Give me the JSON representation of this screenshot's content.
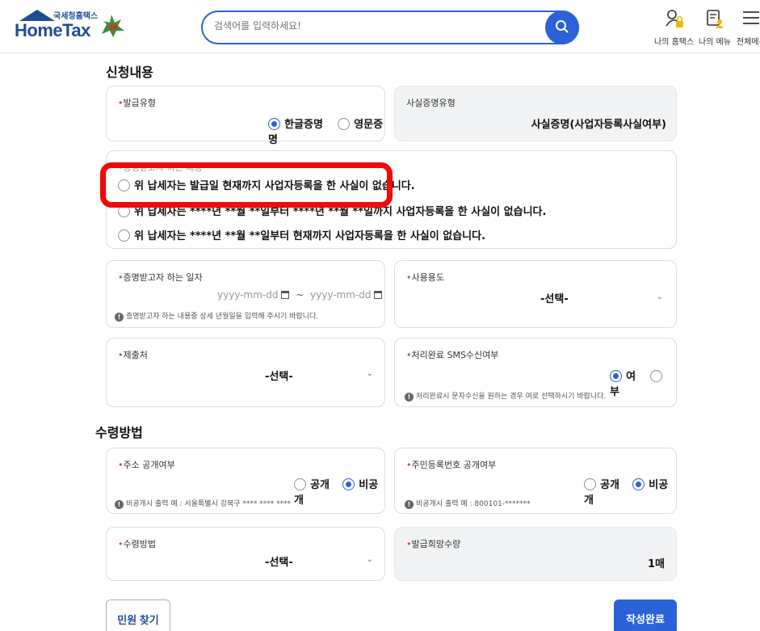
{
  "header": {
    "logo_small": "국세청홈택스",
    "logo_big": "HomeTax",
    "search_placeholder": "검색어를 입력하세요!",
    "nav": [
      {
        "label": "나의 홈택스",
        "icon": "person-lock-icon"
      },
      {
        "label": "나의 메뉴",
        "icon": "document-person-icon"
      },
      {
        "label": "전체메뉴",
        "icon": "menu-icon"
      }
    ]
  },
  "apply": {
    "title": "신청내용",
    "issue_type": {
      "label": "발급유형",
      "options": [
        "한글증명",
        "영문증명"
      ],
      "selected": "한글증명"
    },
    "fact_type": {
      "label": "사실증명유형",
      "value": "사실증명(사업자등록사실여부)"
    },
    "content": {
      "label": "증명받고자 하는 내용",
      "options": [
        "위 납세자는 발급일 현재까지 사업자등록을 한 사실이 없습니다.",
        "위 납세자는 ****년 **월 **일부터 ****년 **월 **일까지 사업자등록을 한 사실이 없습니다.",
        "위 납세자는 ****년 **월 **일부터 현재까지 사업자등록을 한 사실이 없습니다."
      ]
    },
    "date": {
      "label": "증명받고자 하는 일자",
      "from_placeholder": "yyyy-mm-dd",
      "separator": "~",
      "to_placeholder": "yyyy-mm-dd",
      "hint": "증명받고자 하는 내용중 상세 년월일을 입력해 주시기 바랍니다."
    },
    "usage": {
      "label": "사용용도",
      "value": "-선택-"
    },
    "submit_to": {
      "label": "제출처",
      "value": "-선택-"
    },
    "sms": {
      "label": "처리완료 SMS수신여부",
      "options": [
        "여",
        "부"
      ],
      "selected": "여",
      "hint": "처리완료시 문자수신을 원하는 경우 여로 선택하시기 바랍니다."
    }
  },
  "receive": {
    "title": "수령방법",
    "address_public": {
      "label": "주소 공개여부",
      "options": [
        "공개",
        "비공개"
      ],
      "selected": "비공개",
      "hint": "비공개시 출력 예 : 서울특별시 강북구 **** **** ****"
    },
    "rrn_public": {
      "label": "주민등록번호 공개여부",
      "options": [
        "공개",
        "비공개"
      ],
      "selected": "비공개",
      "hint": "비공개시 출력 예 : 800101-*******"
    },
    "method": {
      "label": "수령방법",
      "value": "-선택-"
    },
    "quantity": {
      "label": "발급희망수량",
      "value": "1매"
    }
  },
  "footer": {
    "find_label": "민원 찾기",
    "submit_label": "작성완료"
  },
  "colors": {
    "primary": "#2b62d8",
    "brand": "#1f4e96",
    "highlight": "#f00a0a",
    "required": "#e53935"
  }
}
